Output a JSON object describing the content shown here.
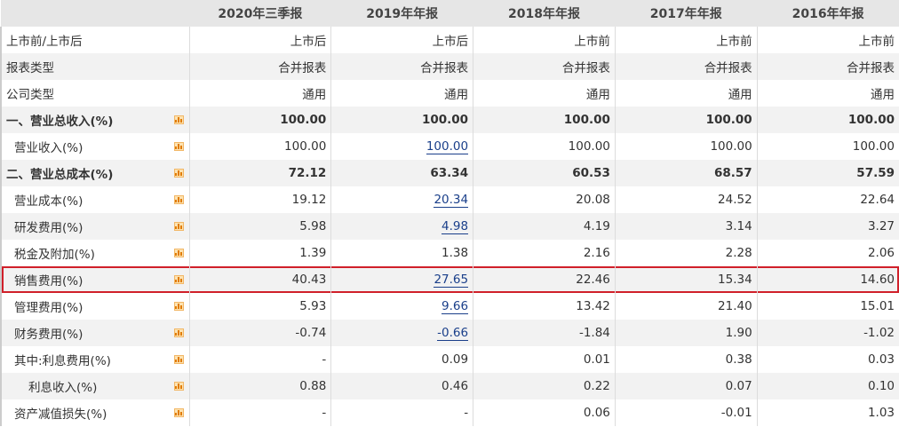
{
  "headers": [
    "",
    "2020年三季报",
    "2019年年报",
    "2018年年报",
    "2017年年报",
    "2016年年报"
  ],
  "rows": [
    {
      "label": "上市前/上市后",
      "values": [
        "上市后",
        "上市后",
        "上市前",
        "上市前",
        "上市前"
      ],
      "icon": false,
      "indent": 0
    },
    {
      "label": "报表类型",
      "values": [
        "合并报表",
        "合并报表",
        "合并报表",
        "合并报表",
        "合并报表"
      ],
      "icon": false,
      "indent": 0
    },
    {
      "label": "公司类型",
      "values": [
        "通用",
        "通用",
        "通用",
        "通用",
        "通用"
      ],
      "icon": false,
      "indent": 0
    },
    {
      "label": "一、营业总收入(%)",
      "values": [
        "100.00",
        "100.00",
        "100.00",
        "100.00",
        "100.00"
      ],
      "icon": true,
      "bold": true,
      "indent": 0
    },
    {
      "label": "营业收入(%)",
      "values": [
        "100.00",
        "100.00",
        "100.00",
        "100.00",
        "100.00"
      ],
      "icon": true,
      "indent": 1,
      "link": true
    },
    {
      "label": "二、营业总成本(%)",
      "values": [
        "72.12",
        "63.34",
        "60.53",
        "68.57",
        "57.59"
      ],
      "icon": true,
      "bold": true,
      "indent": 0
    },
    {
      "label": "营业成本(%)",
      "values": [
        "19.12",
        "20.34",
        "20.08",
        "24.52",
        "22.64"
      ],
      "icon": true,
      "indent": 1,
      "link": true
    },
    {
      "label": "研发费用(%)",
      "values": [
        "5.98",
        "4.98",
        "4.19",
        "3.14",
        "3.27"
      ],
      "icon": true,
      "indent": 1,
      "link": true
    },
    {
      "label": "税金及附加(%)",
      "values": [
        "1.39",
        "1.38",
        "2.16",
        "2.28",
        "2.06"
      ],
      "icon": true,
      "indent": 1
    },
    {
      "label": "销售费用(%)",
      "values": [
        "40.43",
        "27.65",
        "22.46",
        "15.34",
        "14.60"
      ],
      "icon": true,
      "indent": 1,
      "link": true,
      "highlight": true
    },
    {
      "label": "管理费用(%)",
      "values": [
        "5.93",
        "9.66",
        "13.42",
        "21.40",
        "15.01"
      ],
      "icon": true,
      "indent": 1,
      "link": true
    },
    {
      "label": "财务费用(%)",
      "values": [
        "-0.74",
        "-0.66",
        "-1.84",
        "1.90",
        "-1.02"
      ],
      "icon": true,
      "indent": 1,
      "link": true
    },
    {
      "label": "其中:利息费用(%)",
      "values": [
        "-",
        "0.09",
        "0.01",
        "0.38",
        "0.03"
      ],
      "icon": true,
      "indent": 1
    },
    {
      "label": "利息收入(%)",
      "values": [
        "0.88",
        "0.46",
        "0.22",
        "0.07",
        "0.10"
      ],
      "icon": true,
      "indent": 2
    },
    {
      "label": "资产减值损失(%)",
      "values": [
        "-",
        "-",
        "0.06",
        "-0.01",
        "1.03"
      ],
      "icon": true,
      "indent": 1
    }
  ]
}
